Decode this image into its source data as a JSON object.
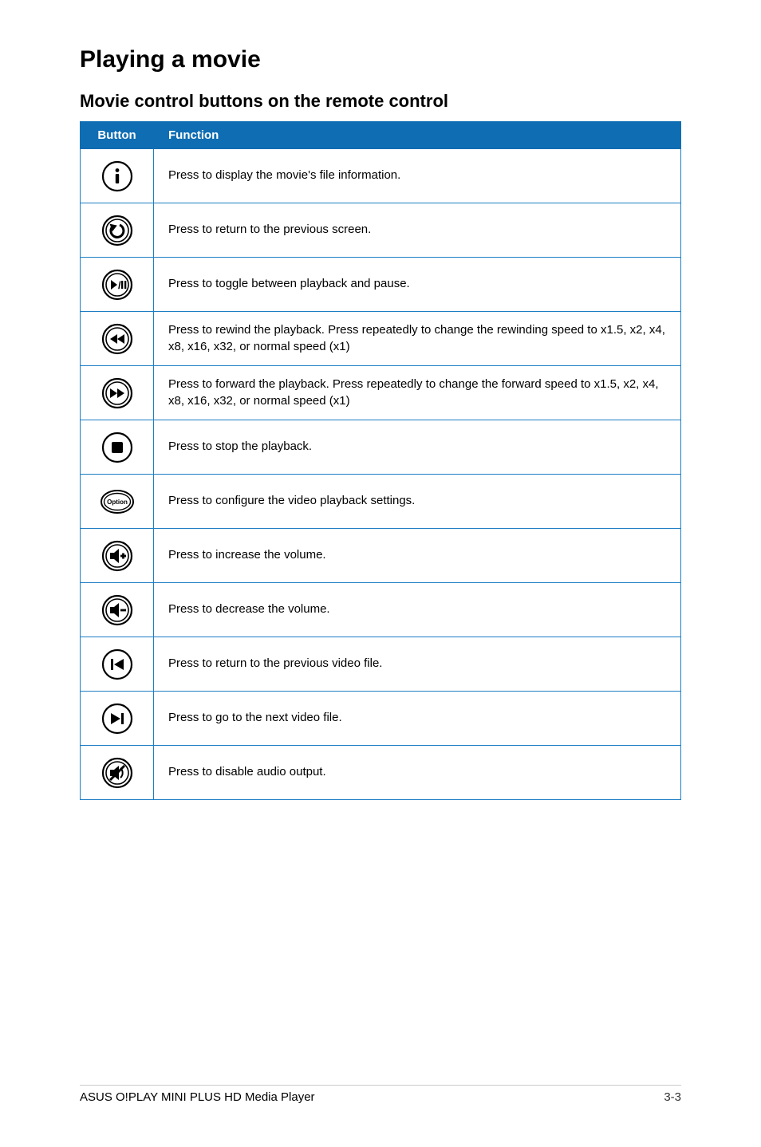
{
  "title": "Playing a movie",
  "subtitle": "Movie control buttons on the remote control",
  "headers": {
    "button": "Button",
    "function": "Function"
  },
  "rows": [
    {
      "icon": "info-icon",
      "func": "Press to display the movie's file information."
    },
    {
      "icon": "back-icon",
      "func": "Press to return to the previous screen."
    },
    {
      "icon": "play-pause-icon",
      "func": "Press to toggle between playback and pause."
    },
    {
      "icon": "rewind-icon",
      "func": "Press to rewind the playback. Press repeatedly to change the rewinding speed to x1.5, x2, x4, x8, x16, x32, or normal speed (x1)"
    },
    {
      "icon": "forward-icon",
      "func": "Press to forward the playback. Press repeatedly to change the forward speed to x1.5, x2, x4, x8, x16, x32, or normal speed (x1)"
    },
    {
      "icon": "stop-icon",
      "func": "Press to stop the playback."
    },
    {
      "icon": "option-icon",
      "func": "Press to configure the video playback settings."
    },
    {
      "icon": "volume-up-icon",
      "func": "Press to increase the volume."
    },
    {
      "icon": "volume-down-icon",
      "func": "Press to decrease the volume."
    },
    {
      "icon": "prev-file-icon",
      "func": "Press to return to the previous video file."
    },
    {
      "icon": "next-file-icon",
      "func": "Press to go to the next video file."
    },
    {
      "icon": "mute-icon",
      "func": "Press to disable audio output."
    }
  ],
  "footer": {
    "product": "ASUS O!PLAY MINI PLUS HD Media Player",
    "page": "3-3"
  },
  "icon_labels": {
    "option": "Option"
  }
}
